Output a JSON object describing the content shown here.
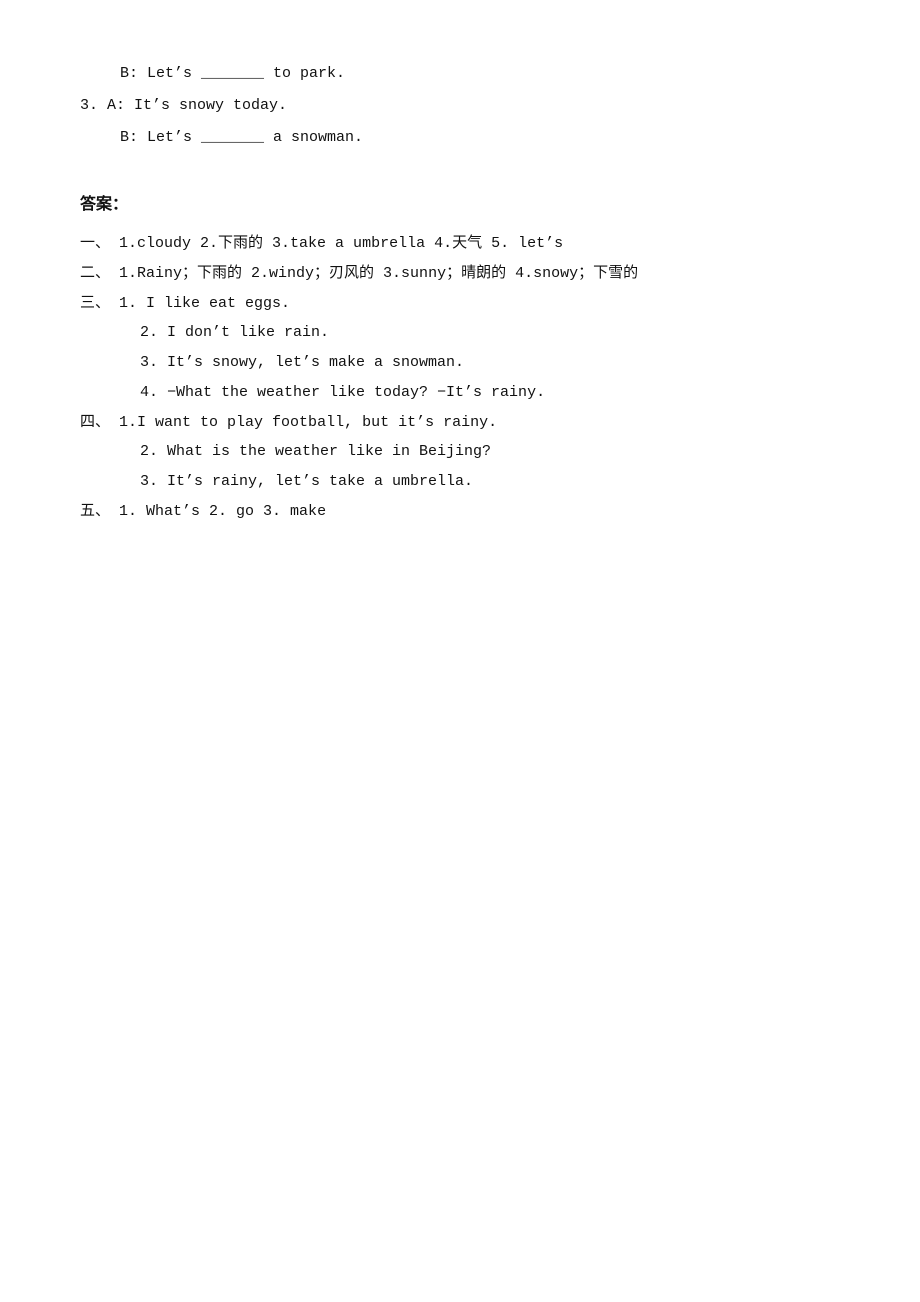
{
  "top_section": {
    "line1": "B: Let’s _______ to park.",
    "line2": "3. A: It’s snowy today.",
    "line3": "   B: Let’s _______ a snowman."
  },
  "answers": {
    "title": "答案：",
    "yi_label": "一、",
    "yi_content": "1.cloudy      2.下雨的        3.take a umbrella      4.天气     5. let’s",
    "er_label": "二、",
    "er_content": "1.Rainy；下雨的      2.windy；刃风的    3.sunny；晴朗的      4.snowy；下雪的",
    "san_label": "三、",
    "san_items": [
      "1. I like eat eggs.",
      "2. I don’t like rain.",
      "3. It’s snowy, let’s make a snowman.",
      "4. −What the weather like today? −It’s rainy."
    ],
    "si_label": "四、",
    "si_items": [
      "1.I want to play football, but it’s rainy.",
      "2. What is the weather like in Beijing?",
      "3. It’s rainy, let’s take a umbrella."
    ],
    "wu_label": "五、",
    "wu_content": "1. What’s      2. go      3. make"
  }
}
